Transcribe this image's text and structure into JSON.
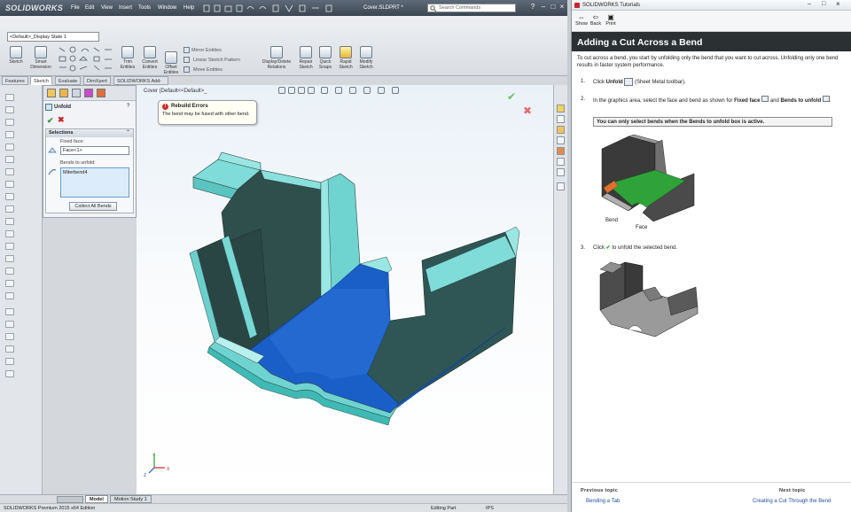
{
  "app": {
    "logo_text": "SOLIDWORKS",
    "menu": [
      "File",
      "Edit",
      "View",
      "Insert",
      "Tools",
      "Window",
      "Help"
    ],
    "document_title": "Cover.SLDPRT *",
    "search_placeholder": "Search Commands",
    "config": "<Default>_Display State 1"
  },
  "command_manager": {
    "buttons": [
      {
        "id": "sketch",
        "label": "Sketch"
      },
      {
        "id": "smart-dimension",
        "label": "Smart Dimension"
      },
      {
        "id": "trim-entities",
        "label": "Trim Entities"
      },
      {
        "id": "convert-entities",
        "label": "Convert Entities"
      },
      {
        "id": "offset-entities",
        "label": "Offset Entities"
      },
      {
        "id": "display-delete-relations",
        "label": "Display/Delete Relations"
      },
      {
        "id": "repair-sketch",
        "label": "Repair Sketch"
      },
      {
        "id": "quick-snaps",
        "label": "Quick Snaps"
      },
      {
        "id": "rapid-sketch",
        "label": "Rapid Sketch"
      },
      {
        "id": "modify-sketch",
        "label": "Modify Sketch"
      }
    ],
    "mirror_entities": "Mirror Entities",
    "linear_sketch_pattern": "Linear Sketch Pattern",
    "move_entities": "Move Entities"
  },
  "tabs": [
    "Features",
    "Sketch",
    "Evaluate",
    "DimXpert",
    "SOLIDWORKS Add-Ins"
  ],
  "property_manager": {
    "title": "Unfold",
    "selections_header": "Selections",
    "fixed_face_label": "Fixed face:",
    "fixed_face_value": "Face<1>",
    "bends_label": "Bends to unfold:",
    "bends_value": "Miterbend4",
    "collect_button": "Collect All Bends"
  },
  "viewport": {
    "breadcrumb": "Cover (Default<<Default>_",
    "rebuild_title": "Rebuild Errors",
    "rebuild_message": "The bend may be fused with other bend.",
    "triad_x": "X",
    "triad_y": "Y",
    "triad_z": "Z"
  },
  "bottom_tabs": [
    "Model",
    "Motion Study 1"
  ],
  "status": {
    "edition": "SOLIDWORKS Premium 2015 x64 Edition",
    "mode": "Editing Part",
    "units": "IPS"
  },
  "tutorial": {
    "window_title": "SOLIDWORKS Tutorials",
    "toolbar": {
      "show": "Show",
      "back": "Back",
      "print": "Print"
    },
    "heading": "Adding a Cut Across a Bend",
    "intro": "To cut across a bend, you start by unfolding only the bend that you want to cut across. Unfolding only one bend results in faster system performance.",
    "step1_num": "1.",
    "step1_pre": "Click ",
    "step1_bold": "Unfold",
    "step1_post": " (Sheet Metal toolbar).",
    "step2_num": "2.",
    "step2_pre": "In the graphics area, select the face and bend as shown for ",
    "step2_b1": "Fixed face",
    "step2_mid": " and ",
    "step2_b2": "Bends to unfold",
    "step2_end": ".",
    "note": "You can only select bends when the Bends to unfold box is active.",
    "fig_bend": "Bend",
    "fig_face": "Face",
    "step3_num": "3.",
    "step3_pre": "Click ",
    "step3_post": " to unfold the selected bend.",
    "previous_title": "Previous topic",
    "previous_link": "Bending a Tab",
    "next_title": "Next topic",
    "next_link": "Creating a Cut Through the Bend"
  },
  "colors": {
    "part_body": "#6fd3d0",
    "part_shadow": "#2f5a57",
    "fixed_face": "#1a5fc7",
    "banner": "#2b3033",
    "link": "#1d4f9e"
  }
}
